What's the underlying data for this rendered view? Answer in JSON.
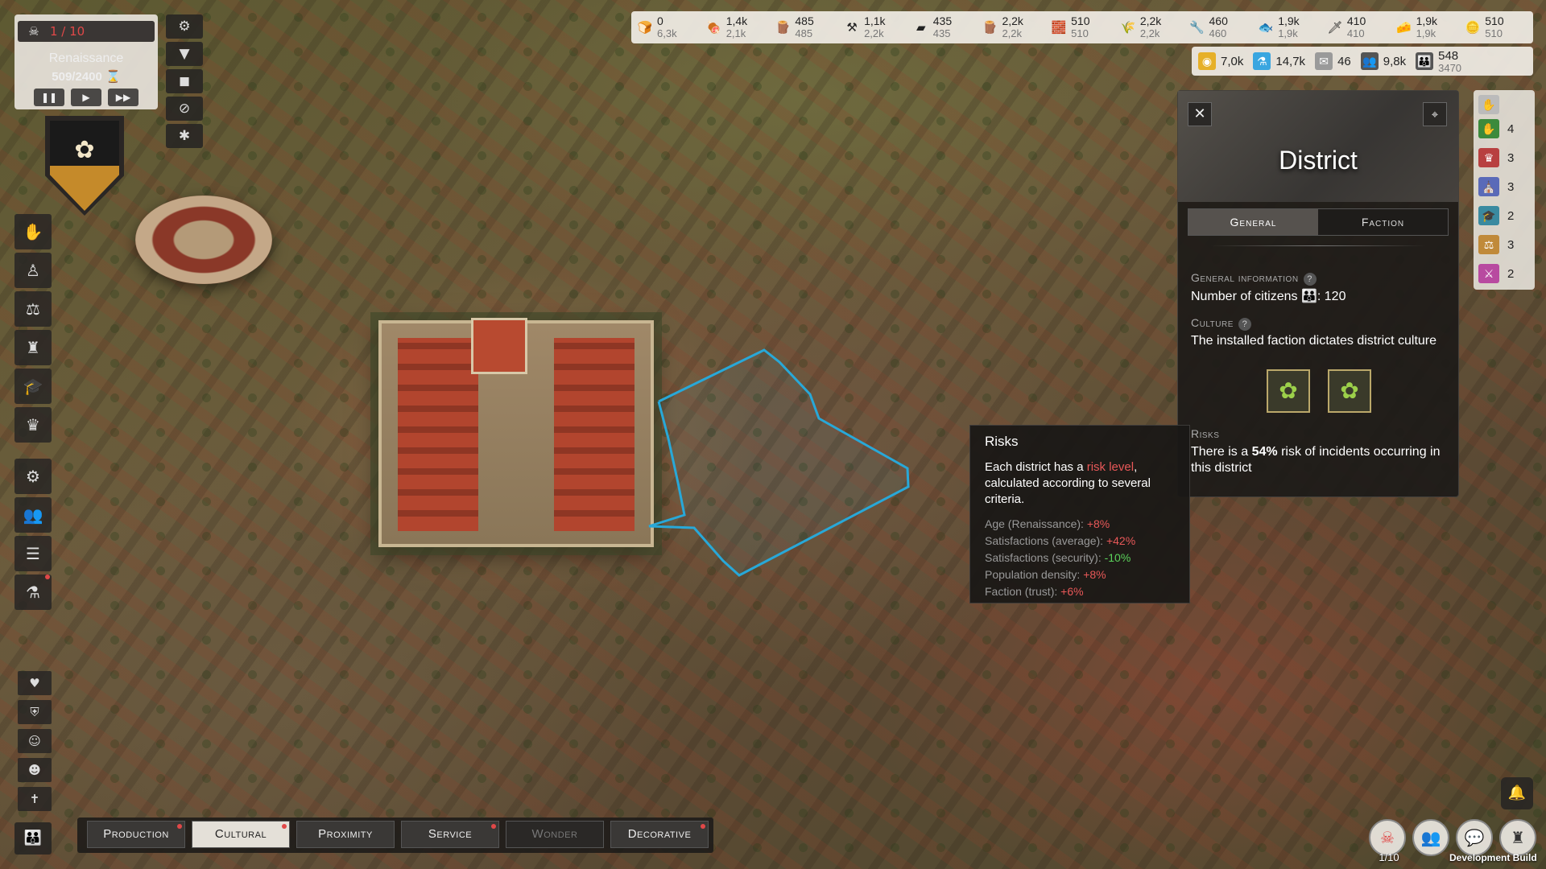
{
  "hud": {
    "risk_counter": "1 / 10",
    "era": "Renaissance",
    "era_progress": "509/2400",
    "speed_buttons": [
      "❚❚",
      "▶",
      "▶▶"
    ]
  },
  "resources": [
    {
      "icon": "bread-icon",
      "glyph": "🍞",
      "value": "0",
      "max": "6,3k"
    },
    {
      "icon": "meat-icon",
      "glyph": "🍖",
      "value": "1,4k",
      "max": "2,1k"
    },
    {
      "icon": "plank-icon",
      "glyph": "🪵",
      "value": "485",
      "max": "485"
    },
    {
      "icon": "anvil-icon",
      "glyph": "⚒",
      "value": "1,1k",
      "max": "2,2k"
    },
    {
      "icon": "ingot-icon",
      "glyph": "▰",
      "value": "435",
      "max": "435"
    },
    {
      "icon": "log-icon",
      "glyph": "🪵",
      "value": "2,2k",
      "max": "2,2k"
    },
    {
      "icon": "brick-icon",
      "glyph": "🧱",
      "value": "510",
      "max": "510"
    },
    {
      "icon": "wheat-icon",
      "glyph": "🌾",
      "value": "2,2k",
      "max": "2,2k"
    },
    {
      "icon": "tool-icon",
      "glyph": "🔧",
      "value": "460",
      "max": "460"
    },
    {
      "icon": "fish-icon",
      "glyph": "🐟",
      "value": "1,9k",
      "max": "1,9k"
    },
    {
      "icon": "blade-icon",
      "glyph": "🗡",
      "value": "410",
      "max": "410"
    },
    {
      "icon": "cheese-icon",
      "glyph": "🧀",
      "value": "1,9k",
      "max": "1,9k"
    },
    {
      "icon": "gold-icon",
      "glyph": "🪙",
      "value": "510",
      "max": "510"
    }
  ],
  "stats": [
    {
      "icon": "coins-icon",
      "glyph": "◉",
      "color": "#e6b028",
      "value": "7,0k"
    },
    {
      "icon": "research-icon",
      "glyph": "⚗",
      "color": "#3aa6e0",
      "value": "14,7k"
    },
    {
      "icon": "scroll-icon",
      "glyph": "✉",
      "color": "#9a9a9a",
      "value": "46"
    },
    {
      "icon": "workers-icon",
      "glyph": "👥",
      "color": "#555",
      "value": "9,8k"
    },
    {
      "icon": "population-icon",
      "glyph": "👪",
      "color": "#555",
      "value": "548",
      "max": "3470"
    }
  ],
  "panel": {
    "title": "District",
    "tab_general": "General",
    "tab_faction": "Faction",
    "general_info_header": "General information",
    "citizens_label": "Number of citizens",
    "citizens_value": "120",
    "culture_header": "Culture",
    "culture_text": "The installed faction dictates district culture",
    "risks_header": "Risks",
    "risks_text_pre": "There is a",
    "risks_value": "54%",
    "risks_text_post": "risk of incidents occurring in this district"
  },
  "tooltip": {
    "title": "Risks",
    "body_pre": "Each district has a",
    "body_highlight": "risk level",
    "body_post": ", calculated according to several criteria.",
    "lines": [
      {
        "label": "Age (Renaissance):",
        "value": "+8%",
        "kind": "pos"
      },
      {
        "label": "Satisfactions (average):",
        "value": "+42%",
        "kind": "pos"
      },
      {
        "label": "Satisfactions (security):",
        "value": "-10%",
        "kind": "neg"
      },
      {
        "label": "Population density:",
        "value": "+8%",
        "kind": "pos"
      },
      {
        "label": "Faction (trust):",
        "value": "+6%",
        "kind": "pos"
      }
    ]
  },
  "factions": [
    {
      "icon": "guild-icon",
      "glyph": "✋",
      "color": "#3c8a3c",
      "value": "4"
    },
    {
      "icon": "nobility-icon",
      "glyph": "♛",
      "color": "#b84040",
      "value": "3"
    },
    {
      "icon": "clergy-icon",
      "glyph": "⛪",
      "color": "#5a6ab8",
      "value": "3"
    },
    {
      "icon": "scholars-icon",
      "glyph": "🎓",
      "color": "#3a8aa0",
      "value": "2"
    },
    {
      "icon": "merchants-icon",
      "glyph": "⚖",
      "color": "#c08a3a",
      "value": "3"
    },
    {
      "icon": "military-icon",
      "glyph": "⚔",
      "color": "#b84aa0",
      "value": "2"
    }
  ],
  "categories": [
    {
      "name": "production",
      "label": "Production",
      "state": "normal",
      "dot": true
    },
    {
      "name": "cultural",
      "label": "Cultural",
      "state": "active",
      "dot": true
    },
    {
      "name": "proximity",
      "label": "Proximity",
      "state": "normal",
      "dot": false
    },
    {
      "name": "service",
      "label": "Service",
      "state": "normal",
      "dot": true
    },
    {
      "name": "wonder",
      "label": "Wonder",
      "state": "disabled",
      "dot": false
    },
    {
      "name": "decorative",
      "label": "Decorative",
      "state": "normal",
      "dot": true
    }
  ],
  "bottom_right": {
    "risk_counter": "1/10",
    "dev_build": "Development Build"
  },
  "colors": {
    "risk_red": "#e04848",
    "district_outline": "#28a8d8",
    "positive_green": "#5bd25b"
  }
}
